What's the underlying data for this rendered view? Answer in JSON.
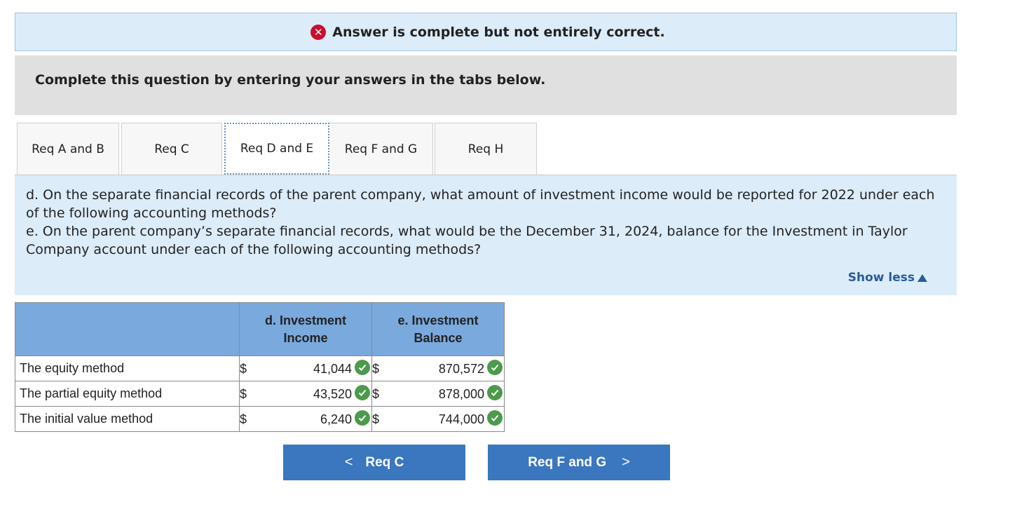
{
  "banner": {
    "icon": "x-circle-icon",
    "text": "Answer is complete but not entirely correct."
  },
  "instructions": "Complete this question by entering your answers in the tabs below.",
  "tabs": [
    {
      "label": "Req A and B"
    },
    {
      "label": "Req C"
    },
    {
      "label": "Req D and E",
      "active": true
    },
    {
      "label": "Req F and G"
    },
    {
      "label": "Req H"
    }
  ],
  "question": {
    "d": "d. On the separate financial records of the parent company, what amount of investment income would be reported for 2022 under each of the following accounting methods?",
    "e": "e. On the parent company’s separate financial records, what would be the December 31, 2024, balance for the Investment in Taylor Company account under each of the following accounting methods?",
    "show_less": "Show less"
  },
  "table": {
    "headers": [
      "",
      "d. Investment Income",
      "e. Investment Balance"
    ],
    "header_lines": [
      [
        "d. Investment",
        "Income"
      ],
      [
        "e. Investment",
        "Balance"
      ]
    ],
    "rows": [
      {
        "label": "The equity method",
        "income_cur": "$",
        "income": "41,044",
        "balance_cur": "$",
        "balance": "870,572"
      },
      {
        "label": "The partial equity method",
        "income_cur": "$",
        "income": "43,520",
        "balance_cur": "$",
        "balance": "878,000"
      },
      {
        "label": "The initial value method",
        "income_cur": "$",
        "income": "6,240",
        "balance_cur": "$",
        "balance": "744,000"
      }
    ]
  },
  "nav": {
    "prev": "Req C",
    "next": "Req F and G"
  },
  "colors": {
    "banner_bg": "#dcecf9",
    "header_bg": "#7aa9de",
    "button": "#3a77bf",
    "check": "#4c9a4c",
    "error": "#c8102e"
  }
}
